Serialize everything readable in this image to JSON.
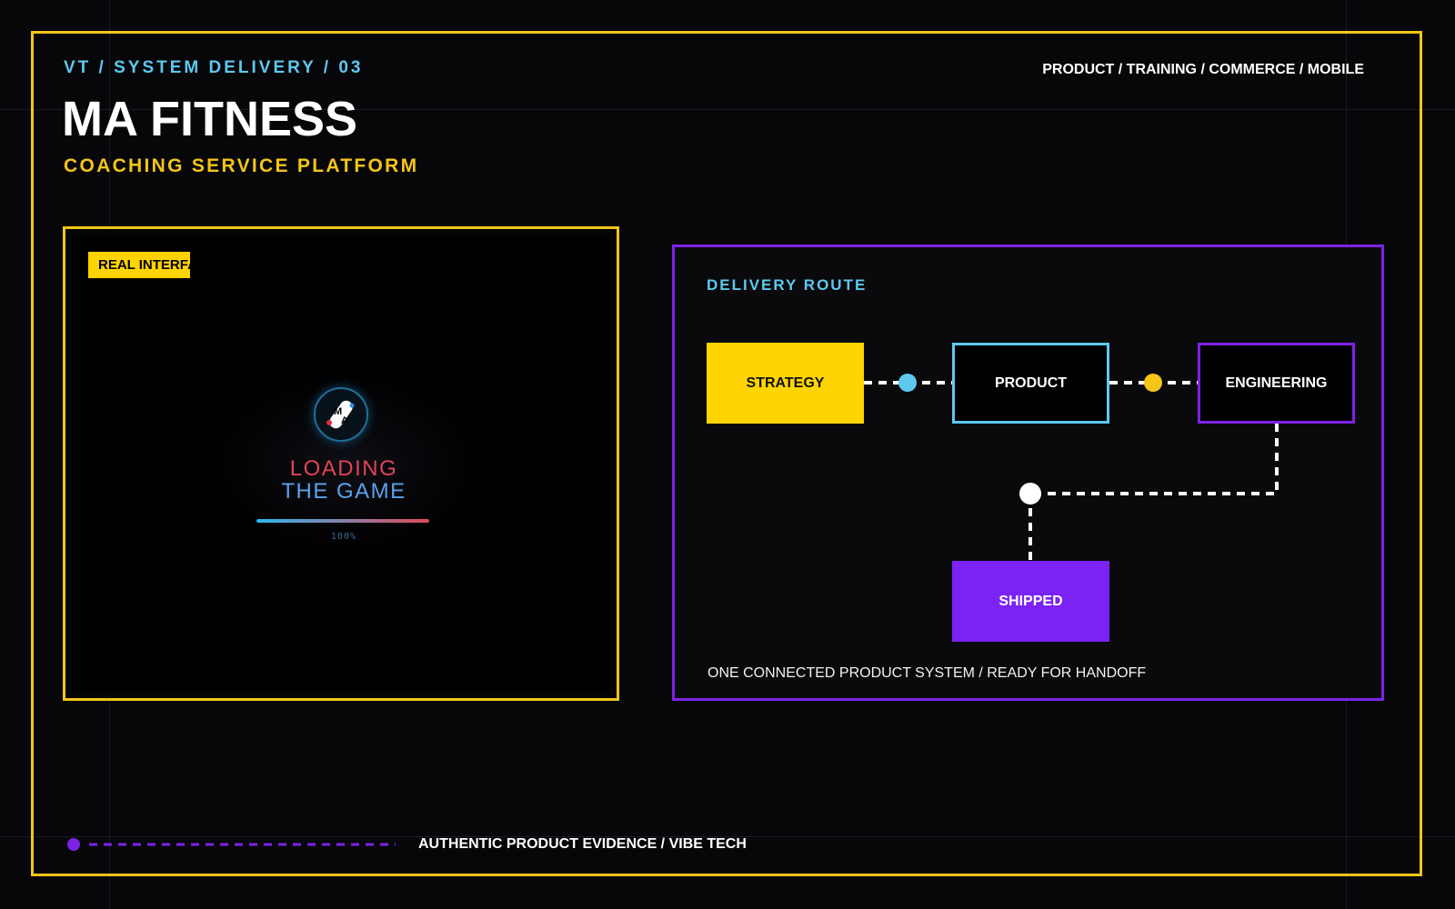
{
  "header": {
    "eyebrow": "VT / SYSTEM DELIVERY / 03",
    "tagline": "PRODUCT / TRAINING / COMMERCE / MOBILE",
    "title": "MA FITNESS",
    "subtitle": "COACHING SERVICE PLATFORM"
  },
  "screenshot_panel": {
    "badge": "REAL INTERFACE",
    "loader": {
      "logo_text": "MA",
      "line1": "LOADING",
      "line2": "THE GAME",
      "progress": 100,
      "percent_label": "100%"
    }
  },
  "route": {
    "title": "DELIVERY ROUTE",
    "nodes": {
      "strategy": "STRATEGY",
      "product": "PRODUCT",
      "engineering": "ENGINEERING",
      "shipped": "SHIPPED"
    },
    "footer": "ONE CONNECTED PRODUCT SYSTEM / READY FOR HANDOFF"
  },
  "footer": {
    "text": "AUTHENTIC PRODUCT EVIDENCE / VIBE TECH"
  },
  "colors": {
    "accent_yellow": "#ffd400",
    "accent_cyan": "#5ec8ef",
    "accent_purple": "#7d22e6",
    "background": "#07070a"
  }
}
